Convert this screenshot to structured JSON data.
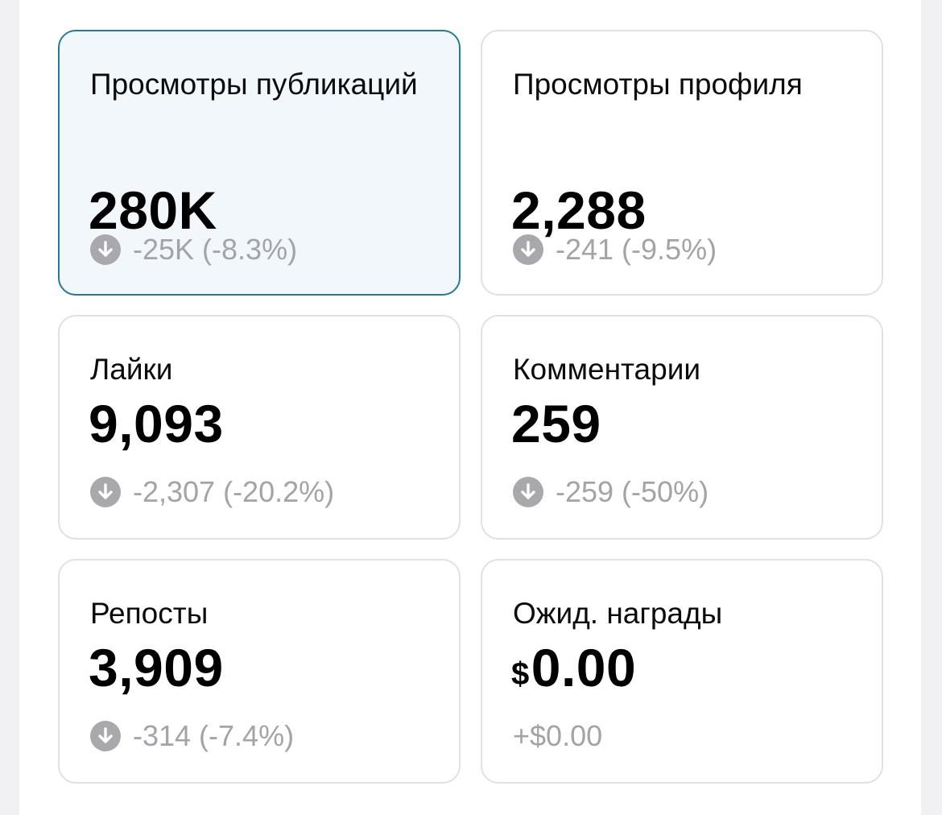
{
  "cards": [
    {
      "title": "Просмотры публикаций",
      "value": "280K",
      "change": "-25K (-8.3%)",
      "trend_icon": "arrow-down-circle-icon",
      "selected": true
    },
    {
      "title": "Просмотры профиля",
      "value": "2,288",
      "change": "-241 (-9.5%)",
      "trend_icon": "arrow-down-circle-icon",
      "selected": false
    },
    {
      "title": "Лайки",
      "value": "9,093",
      "change": "-2,307 (-20.2%)",
      "trend_icon": "arrow-down-circle-icon",
      "selected": false
    },
    {
      "title": "Комментарии",
      "value": "259",
      "change": "-259 (-50%)",
      "trend_icon": "arrow-down-circle-icon",
      "selected": false
    },
    {
      "title": "Репосты",
      "value": "3,909",
      "change": "-314 (-7.4%)",
      "trend_icon": "arrow-down-circle-icon",
      "selected": false
    },
    {
      "title": "Ожид. награды",
      "value_currency": "$",
      "value": "0.00",
      "change": "+$0.00",
      "selected": false
    }
  ],
  "colors": {
    "selected_border": "#257a96",
    "selected_background": "#f2f7fc",
    "change_text": "#a3a3a8",
    "trend_icon": "#a8a8ad"
  }
}
